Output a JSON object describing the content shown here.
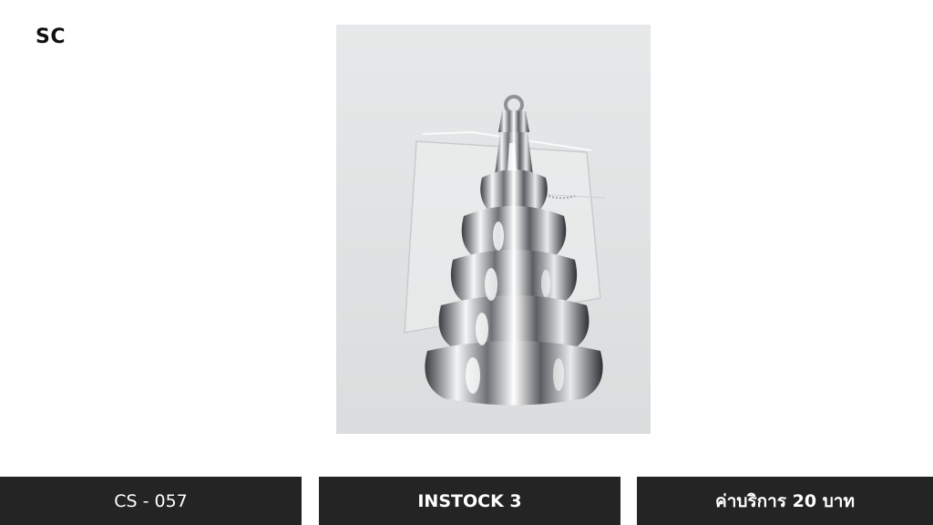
{
  "brand": {
    "text": "SC"
  },
  "product_image": {
    "subject": "silver-christmas-tree-ornament",
    "background_color": "#e3e5e6"
  },
  "info_bars": {
    "code": "CS - 057",
    "stock": "INSTOCK 3",
    "price": "ค่าบริการ 20 บาท"
  },
  "colors": {
    "bar_background": "#242424",
    "bar_text": "#ffffff"
  }
}
